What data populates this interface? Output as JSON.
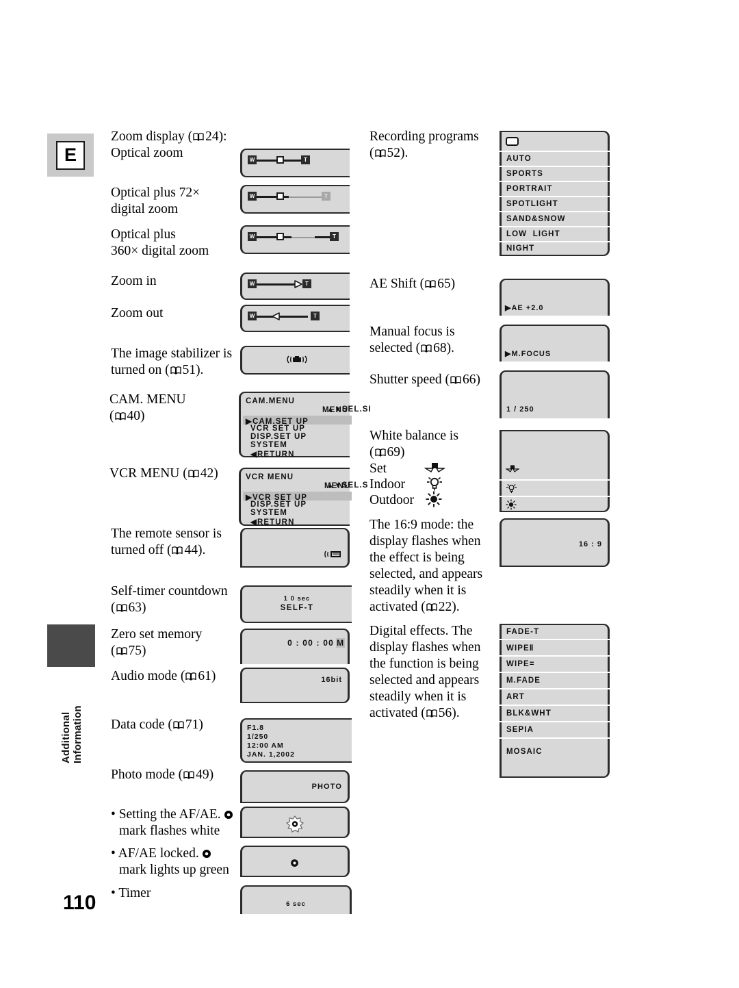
{
  "page": {
    "number": "110",
    "chapter_letter": "E",
    "side_tab_line1": "Additional",
    "side_tab_line2": "Information"
  },
  "left_column": {
    "items": [
      {
        "id": "zoom-display",
        "lines": [
          "Zoom display (",
          "24):",
          "Optical zoom"
        ],
        "text": "Zoom display ( 24): Optical zoom",
        "ref": "24"
      },
      {
        "id": "optical-plus-72",
        "text": "Optical plus 72× digital zoom",
        "ref": ""
      },
      {
        "id": "optical-plus-360",
        "text": "Optical plus 360× digital zoom",
        "ref": ""
      },
      {
        "id": "zoom-in",
        "text": "Zoom in",
        "ref": ""
      },
      {
        "id": "zoom-out",
        "text": "Zoom out",
        "ref": ""
      },
      {
        "id": "image-stabilizer",
        "text": "The image stabilizer is turned on ( 51).",
        "ref": "51"
      },
      {
        "id": "cam-menu",
        "text": "CAM. MENU ( 40)",
        "ref": "40"
      },
      {
        "id": "vcr-menu",
        "text": "VCR MENU ( 42)",
        "ref": "42"
      },
      {
        "id": "remote-sensor",
        "text": "The remote sensor is turned off ( 44).",
        "ref": "44"
      },
      {
        "id": "self-timer",
        "text": "Self-timer countdown ( 63)",
        "ref": "63"
      },
      {
        "id": "zero-set-memory",
        "text": "Zero set memory ( 75)",
        "ref": "75"
      },
      {
        "id": "audio-mode",
        "text": "Audio mode ( 61)",
        "ref": "61"
      },
      {
        "id": "data-code",
        "text": "Data code ( 71)",
        "ref": "71"
      },
      {
        "id": "photo-mode",
        "text": "Photo mode ( 49)",
        "ref": "49"
      },
      {
        "id": "setting-afae",
        "text": "• Setting the AF/AE. mark flashes white",
        "ref": ""
      },
      {
        "id": "afae-locked",
        "text": "• AF/AE locked. mark lights up green",
        "ref": ""
      },
      {
        "id": "timer",
        "text": "• Timer",
        "ref": ""
      }
    ],
    "labels": {
      "zoom_display_a": "Zoom display (",
      "zoom_display_ref": "24):",
      "optical_zoom": "Optical zoom",
      "optical_plus_72_l1": "Optical plus 72×",
      "optical_plus_72_l2": "digital zoom",
      "optical_plus_360_l1": "Optical plus",
      "optical_plus_360_l2": "360× digital zoom",
      "zoom_in": "Zoom in",
      "zoom_out": "Zoom out",
      "stabilizer_l1": "The image stabilizer is",
      "stabilizer_l2a": "turned on (",
      "stabilizer_l2b": "51).",
      "cam_menu_l1": "CAM. MENU",
      "cam_menu_l2a": "(",
      "cam_menu_l2b": "40)",
      "vcr_menu_a": "VCR MENU (",
      "vcr_menu_b": "42)",
      "remote_l1": "The remote sensor is",
      "remote_l2a": "turned off (",
      "remote_l2b": "44).",
      "selftimer_l1": "Self-timer countdown",
      "selftimer_l2a": "(",
      "selftimer_l2b": "63)",
      "zeroset_l1": "Zero set memory",
      "zeroset_l2a": "(",
      "zeroset_l2b": "75)",
      "audio_a": "Audio mode (",
      "audio_b": "61)",
      "datacode_a": "Data code (",
      "datacode_b": "71)",
      "photo_a": "Photo mode (",
      "photo_b": "49)",
      "afae_set_l1": "• Setting the AF/AE.",
      "afae_set_l2": "mark flashes white",
      "afae_lock_l1": "• AF/AE locked.",
      "afae_lock_l2": "mark lights up green",
      "timer": "• Timer"
    }
  },
  "right_column": {
    "labels": {
      "recording_l1": "Recording programs",
      "recording_l2a": "(",
      "recording_l2b": "52).",
      "ae_shift_a": "AE Shift (",
      "ae_shift_b": "65)",
      "mfocus_l1": "Manual focus is",
      "mfocus_l2a": "selected (",
      "mfocus_l2b": "68).",
      "shutter_a": "Shutter speed (",
      "shutter_b": "66)",
      "wb_l1": "White balance is",
      "wb_l2a": "(",
      "wb_l2b": "69)",
      "wb_set": "Set",
      "wb_indoor": "Indoor",
      "wb_outdoor": "Outdoor",
      "wide_l1": "The 16:9 mode: the",
      "wide_l2": "display flashes when",
      "wide_l3": "the effect is being",
      "wide_l4": "selected, and appears",
      "wide_l5": "steadily when it is",
      "wide_l6a": "activated (",
      "wide_l6b": "22).",
      "fx_l1": "Digital effects. The",
      "fx_l2": "display flashes when",
      "fx_l3": "the function is being",
      "fx_l4": "selected and appears",
      "fx_l5": "steadily when it is",
      "fx_l6a": "activated (",
      "fx_l6b": "56)."
    }
  },
  "screens": {
    "cam_menu": {
      "title": "CAM.MENU",
      "hint_line1": "SEL.SI",
      "hint_line2": "MENU",
      "items": [
        "CAM.SET UP",
        "VCR SET UP",
        "DISP.SET UP",
        "SYSTEM",
        "RETURN"
      ],
      "selected_index": 0
    },
    "vcr_menu": {
      "title": "VCR MENU",
      "hint_line1": "SEL.S",
      "hint_line2": "MENU",
      "items": [
        "VCR SET UP",
        "DISP.SET UP",
        "SYSTEM",
        "RETURN"
      ],
      "selected_index": 0
    },
    "self_timer": {
      "line1": "1 0 sec",
      "line2": "SELF-T"
    },
    "zero_set_memory": {
      "value": "0 : 00 : 00",
      "marker": "M"
    },
    "audio_mode": {
      "value": "16bit"
    },
    "data_code": {
      "line1": "F1.8",
      "line2": "1/250",
      "line3": "12:00  AM",
      "line4": "JAN.  1,2002"
    },
    "photo_mode": {
      "value": "PHOTO"
    },
    "timer": {
      "value": "6 sec"
    },
    "ae_shift": {
      "value": "AE  +2.0"
    },
    "manual_focus": {
      "value": "M.FOCUS"
    },
    "shutter_speed": {
      "value": "1 / 250"
    },
    "wide_mode": {
      "value": "16 : 9"
    }
  },
  "recording_programs": {
    "caption": "Recording programs",
    "ref": "52",
    "items": [
      "",
      "AUTO",
      "SPORTS",
      "PORTRAIT",
      "SPOTLIGHT",
      "SAND&SNOW",
      "LOW  LIGHT",
      "NIGHT"
    ]
  },
  "digital_effects": {
    "items": [
      "FADE-T",
      "WIPEⅡ",
      "WIPE=",
      "M.FADE",
      "ART",
      "BLK&WHT",
      "SEPIA",
      "MOSAIC"
    ]
  },
  "white_balance": {
    "items": [
      {
        "name": "set",
        "label": "Set"
      },
      {
        "name": "indoor",
        "label": "Indoor"
      },
      {
        "name": "outdoor",
        "label": "Outdoor"
      }
    ]
  },
  "colors": {
    "screen_bg": "#d8d8d8",
    "screen_border": "#2b2b2b",
    "chip_bg": "#c9c9c9",
    "dark_tab": "#4a4a4a",
    "highlight": "#bdbdbd"
  }
}
